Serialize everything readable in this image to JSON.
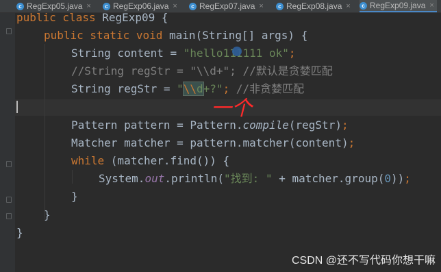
{
  "tabs": [
    {
      "label": "RegExp05.java",
      "active": false
    },
    {
      "label": "RegExp06.java",
      "active": false
    },
    {
      "label": "RegExp07.java",
      "active": false
    },
    {
      "label": "RegExp08.java",
      "active": false
    },
    {
      "label": "RegExp09.java",
      "active": true
    }
  ],
  "tab_icon_letter": "c",
  "tab_close": "×",
  "code": {
    "l1_kw": "public class ",
    "l1_rest": "RegExp09 {",
    "l2_kw": "public static void ",
    "l2_rest": "main(String[] args) {",
    "l3_a": "String content = ",
    "l3_str": "\"hello111111 ok\"",
    "l3_end": ";",
    "l4_cmt": "//String regStr = \"\\\\d+\"; //默认是贪婪匹配",
    "l5_a": "String regStr = ",
    "l5_q": "\"",
    "l5_esc": "\\\\",
    "l5_d": "d",
    "l5_rest": "+?",
    "l5_q2": "\"",
    "l5_semi": "; ",
    "l5_cmt": "//非贪婪匹配",
    "l7_a": "Pattern pattern = Pattern.",
    "l7_m": "compile",
    "l7_b": "(regStr)",
    "l7_end": ";",
    "l8_a": "Matcher matcher = pattern.matcher(content)",
    "l8_end": ";",
    "l9_kw": "while ",
    "l9_rest": "(matcher.find()) {",
    "l10_a": "System.",
    "l10_out": "out",
    "l10_b": ".println(",
    "l10_str": "\"找到: \"",
    "l10_c": " + matcher.group(",
    "l10_num": "0",
    "l10_d": "))",
    "l10_end": ";",
    "l11": "}",
    "l12": "}",
    "l13": "}"
  },
  "annotation_text": "一个",
  "annotation_color": "#ff2a2a",
  "watermark": "CSDN @还不写代码你想干嘛"
}
